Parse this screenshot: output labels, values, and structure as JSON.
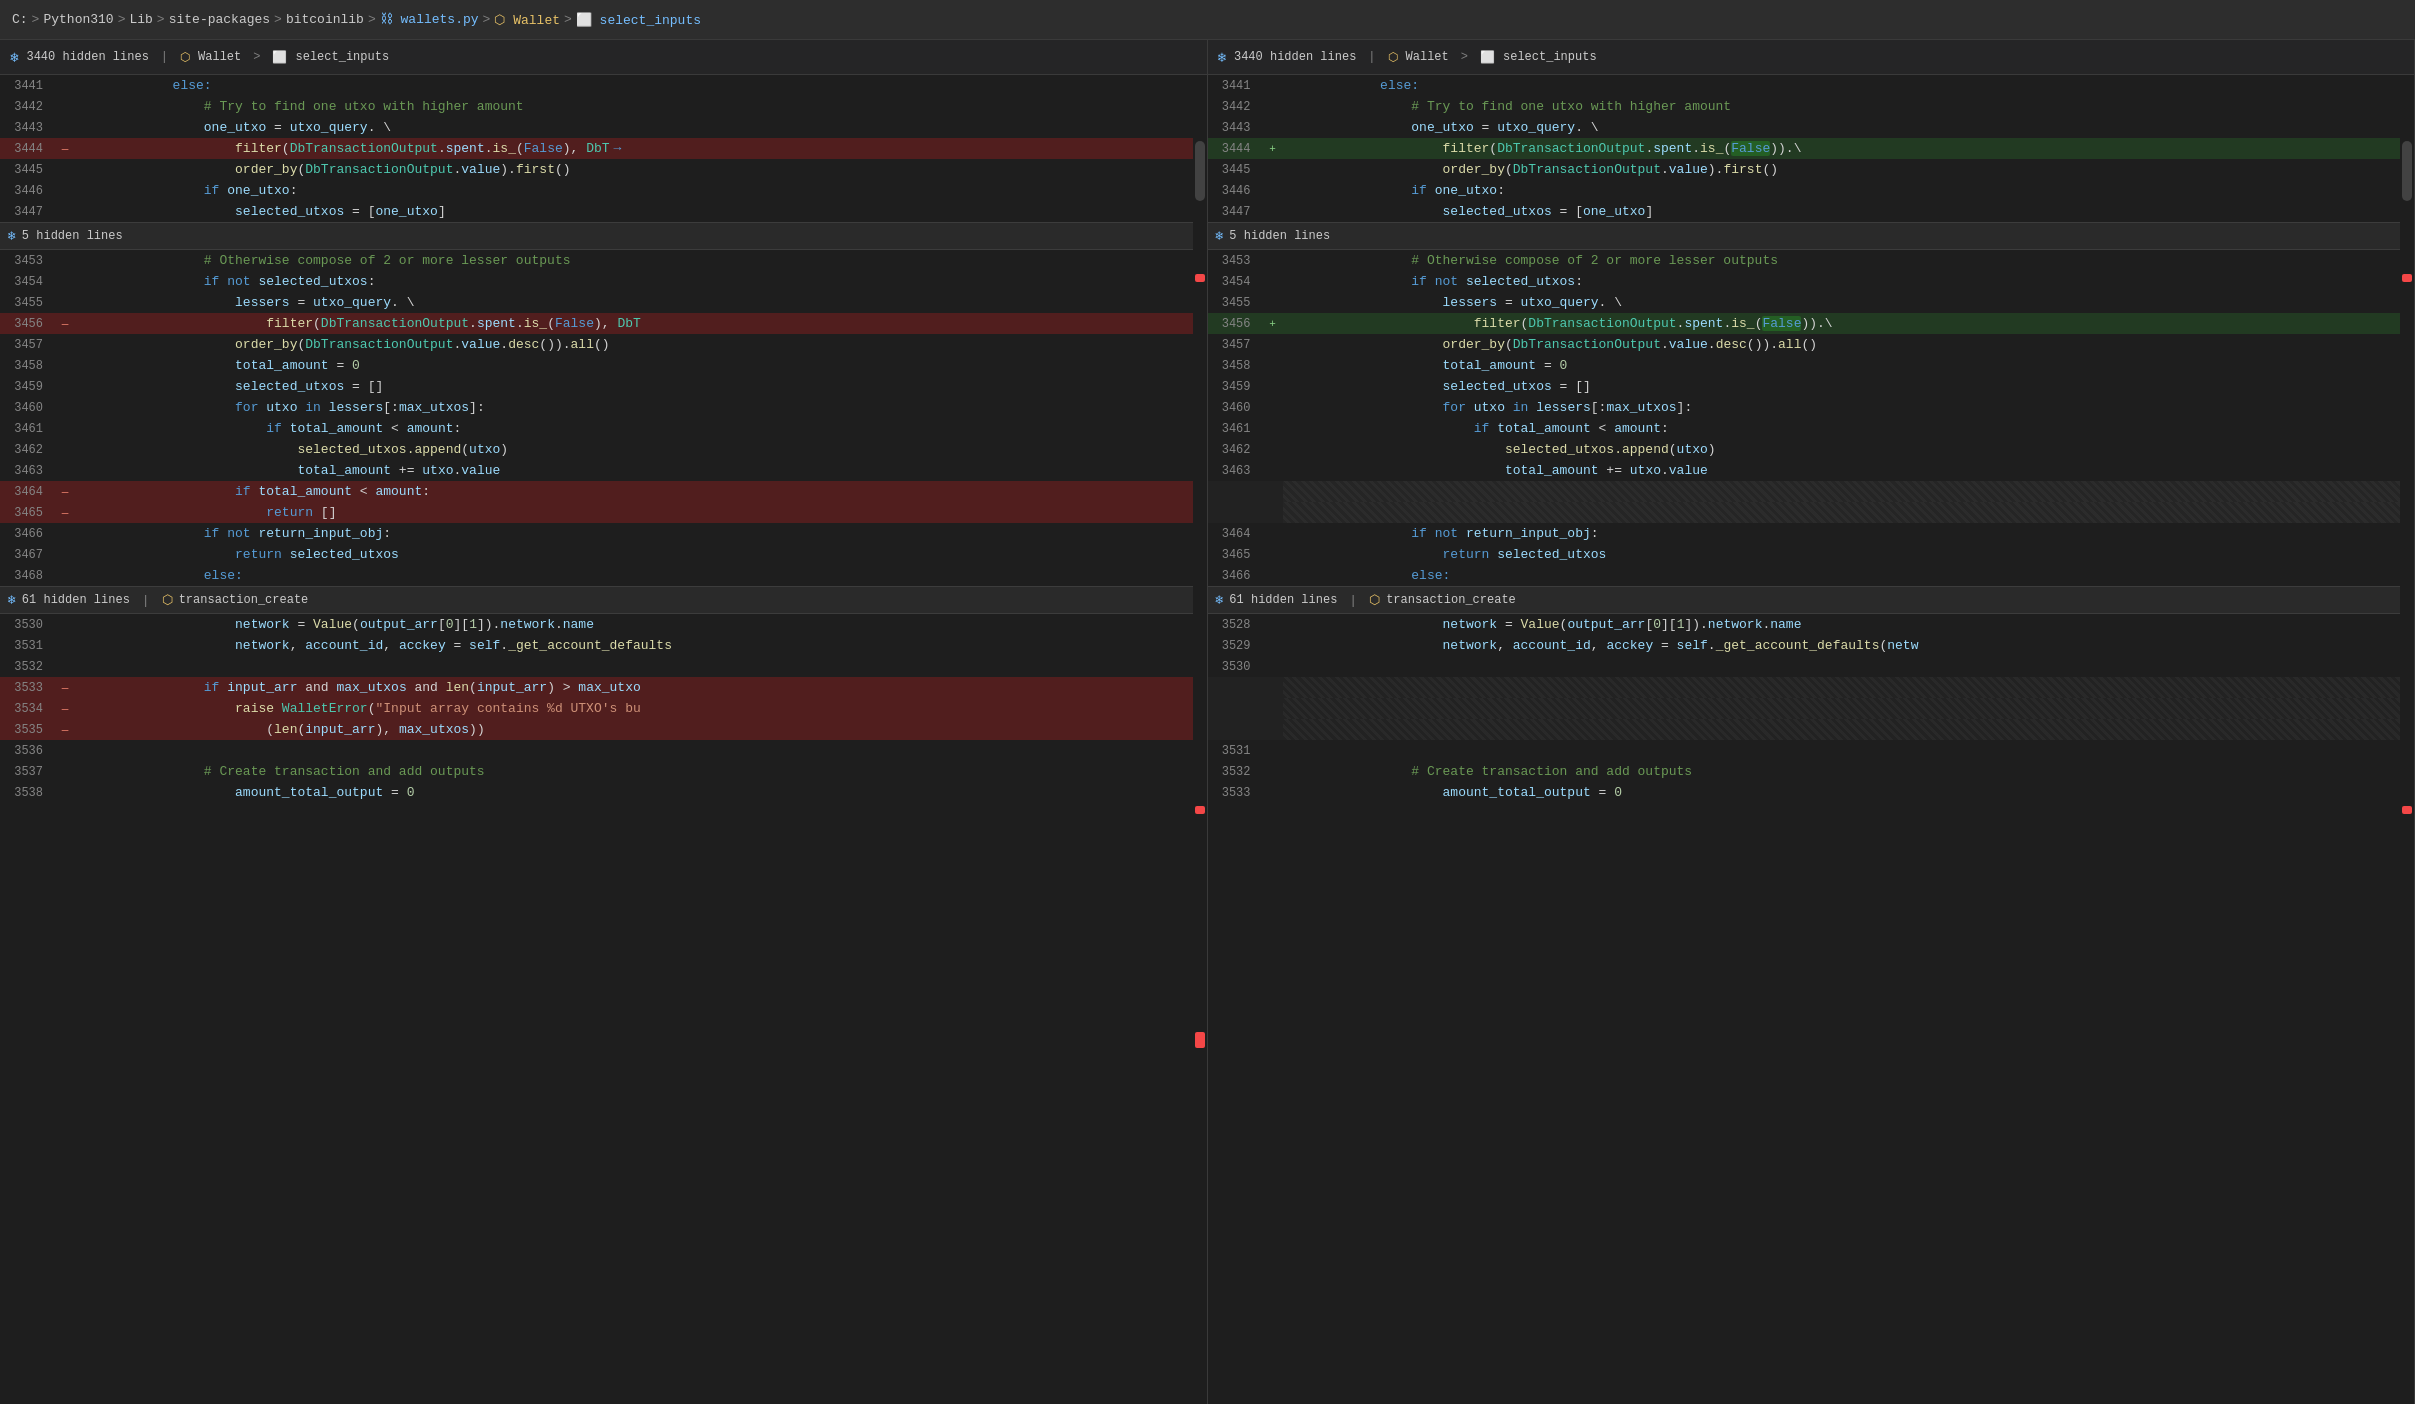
{
  "topbar": {
    "breadcrumb": [
      {
        "label": "C:",
        "sep": false
      },
      {
        "label": ">",
        "sep": true
      },
      {
        "label": "Python310",
        "sep": false
      },
      {
        "label": ">",
        "sep": true
      },
      {
        "label": "Lib",
        "sep": false
      },
      {
        "label": ">",
        "sep": true
      },
      {
        "label": "site-packages",
        "sep": false
      },
      {
        "label": ">",
        "sep": true
      },
      {
        "label": "bitcoinlib",
        "sep": false
      },
      {
        "label": ">",
        "sep": true
      },
      {
        "label": "wallets.py",
        "sep": false
      },
      {
        "label": ">",
        "sep": true
      },
      {
        "label": "Wallet",
        "sep": false
      },
      {
        "label": ">",
        "sep": true
      },
      {
        "label": "select_inputs",
        "sep": false
      }
    ]
  },
  "left_pane": {
    "header": {
      "hidden_lines": "3440 hidden lines",
      "wallet": "Wallet",
      "method": "select_inputs"
    },
    "lines": []
  },
  "right_pane": {
    "header": {
      "hidden_lines": "3440 hidden lines",
      "wallet": "Wallet",
      "method": "select_inputs"
    }
  },
  "colors": {
    "deleted_bg": "rgba(200,30,30,0.3)",
    "added_bg": "rgba(40,130,40,0.4)",
    "accent_blue": "#569cd6",
    "accent_yellow": "#e8c267"
  }
}
